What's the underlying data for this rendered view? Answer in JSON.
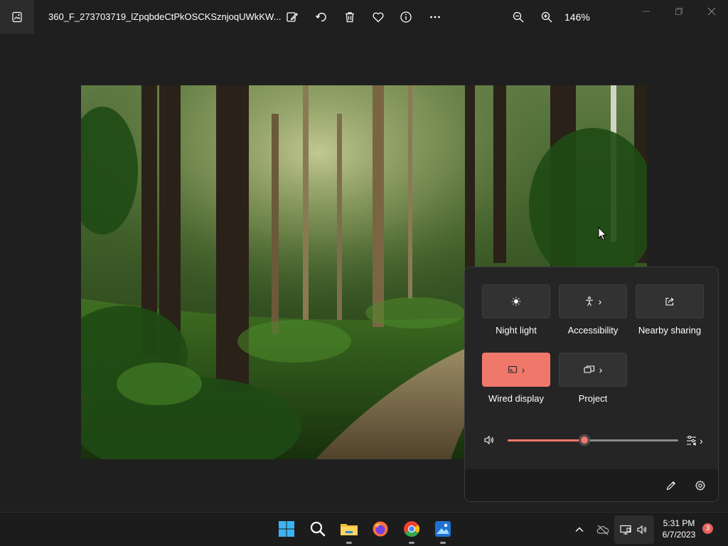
{
  "titlebar": {
    "filename": "360_F_273703719_lZpqbdeCtPkOSCKSznjoqUWkKW...",
    "zoom": "146%",
    "toolbar_icons": [
      "edit-icon",
      "rotate-icon",
      "delete-icon",
      "favorite-icon",
      "info-icon",
      "more-icon"
    ],
    "zoom_icons": [
      "zoom-out-icon",
      "zoom-in-icon"
    ]
  },
  "quick_settings": {
    "tiles": [
      {
        "label": "Night light",
        "icon": "night-light-icon",
        "active": false,
        "has_chevron": false
      },
      {
        "label": "Accessibility",
        "icon": "accessibility-icon",
        "active": false,
        "has_chevron": true
      },
      {
        "label": "Nearby sharing",
        "icon": "share-icon",
        "active": false,
        "has_chevron": false
      },
      {
        "label": "Wired display",
        "icon": "cast-icon",
        "active": true,
        "has_chevron": true
      },
      {
        "label": "Project",
        "icon": "project-icon",
        "active": false,
        "has_chevron": true
      }
    ],
    "volume": {
      "level_percent": 45
    },
    "accent_color": "#f0786a"
  },
  "taskbar": {
    "apps": [
      "start-icon",
      "search-icon",
      "file-explorer-icon",
      "firefox-icon",
      "chrome-icon",
      "photos-icon"
    ],
    "time": "5:31 PM",
    "date": "6/7/2023",
    "notification_count": "3"
  }
}
